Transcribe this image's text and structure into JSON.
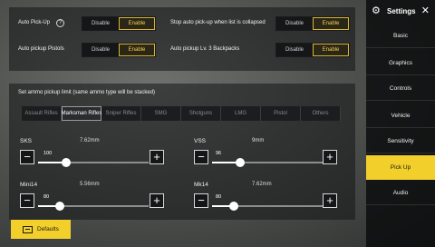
{
  "pickup": {
    "auto_pickup_label": "Auto Pick-Up",
    "auto_pickup_pistols_label": "Auto pickup Pistols",
    "stop_auto_pickup_label": "Stop auto pick-up when list is collapsed",
    "auto_pickup_lv3_label": "Auto pickup Lv. 3 Backpacks",
    "disable_label": "Disable",
    "enable_label": "Enable",
    "auto_pickup_value": "Enable",
    "auto_pickup_pistols_value": "Enable",
    "stop_auto_pickup_value": "Enable",
    "auto_pickup_lv3_value": "Enable"
  },
  "ammo": {
    "title": "Set ammo pickup limit (same ammo type will be stacked)",
    "tabs": [
      "Assault Rifles",
      "Marksman Rifles",
      "Sniper Rifles",
      "SMG",
      "Shotguns",
      "LMG",
      "Pistol",
      "Others"
    ],
    "active_tab": "Marksman Rifles",
    "guns": [
      {
        "name": "SKS",
        "caliber": "7.62mm",
        "value": "100",
        "level": 0.25
      },
      {
        "name": "VSS",
        "caliber": "9mm",
        "value": "96",
        "level": 0.25
      },
      {
        "name": "Mini14",
        "caliber": "5.56mm",
        "value": "80",
        "level": 0.2
      },
      {
        "name": "Mk14",
        "caliber": "7.62mm",
        "value": "80",
        "level": 0.2
      }
    ]
  },
  "defaults_label": "Defaults",
  "sidebar": {
    "title": "Settings",
    "items": [
      "Basic",
      "Graphics",
      "Controls",
      "Vehicle",
      "Sensitivity",
      "Pick Up",
      "Audio"
    ],
    "active": "Pick Up"
  },
  "colors": {
    "accent": "#f2cf2a",
    "toggle_on_text": "#f5d24a"
  }
}
